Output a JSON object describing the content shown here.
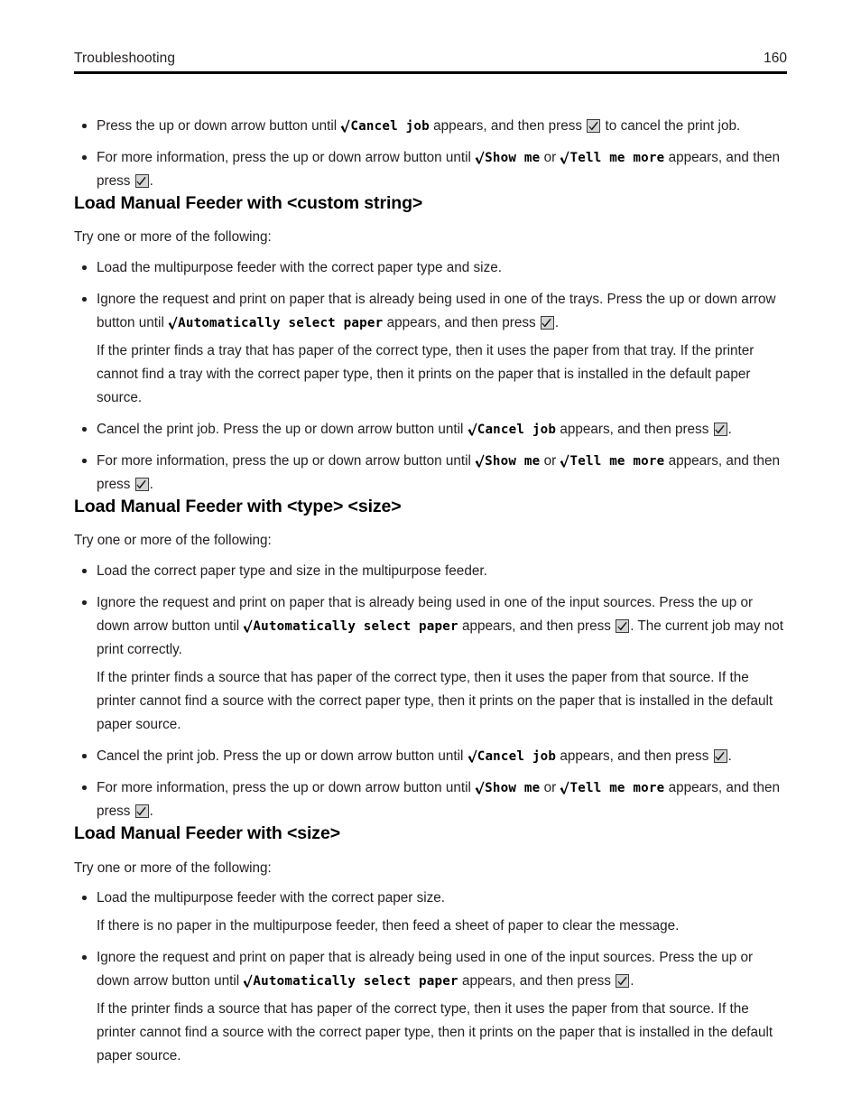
{
  "header": {
    "title": "Troubleshooting",
    "page_number": "160"
  },
  "icons": {
    "radical_check": "radical-check-glyph",
    "select_key": "select-button-checkmark-icon"
  },
  "panel_strings": {
    "cancel_job": "Cancel job",
    "show_me": "Show me",
    "tell_me_more": "Tell me more",
    "automatically_select_paper": "Automatically select paper"
  },
  "intro_text": "Try one or more of the following:",
  "fragments": {
    "press_until": "Press the up or down arrow button until ",
    "appears_then_press": " appears, and then press ",
    "to_cancel": " to cancel the print job.",
    "period": ".",
    "more_info_press_until": "For more information, press the up or down arrow button until ",
    "or": " or ",
    "appears_and": " appears, and",
    "then_press": "then press ",
    "button_until": "button until ",
    "arrow_button_until": "arrow button until ",
    "ignore_trays_lead": "Ignore the request and print on paper that is already being used in one of the trays. Press the up or down arrow",
    "ignore_sources_lead": "Ignore the request and print on paper that is already being used in one of the input sources. Press the up or down",
    "cancel_lead": "Cancel the print job. Press the up or down arrow button until ",
    "current_job_note": ". The current job may not",
    "print_correctly": "print correctly."
  },
  "sections": [
    {
      "heading": "Load Manual Feeder with <custom string>",
      "bullets": [
        {
          "kind": "plain",
          "text": "Load the multipurpose feeder with the correct paper type and size."
        },
        {
          "kind": "ignore-trays"
        },
        {
          "kind": "cancel"
        },
        {
          "kind": "more-info"
        }
      ],
      "notes": {
        "tray_note": "If the printer finds a tray that has paper of the correct type, then it uses the paper from that tray. If the printer cannot find a tray with the correct paper type, then it prints on the paper that is installed in the default paper source."
      }
    },
    {
      "heading": "Load Manual Feeder with <type> <size>",
      "bullets": [
        {
          "kind": "plain",
          "text": "Load the correct paper type and size in the multipurpose feeder."
        },
        {
          "kind": "ignore-sources-current-job"
        },
        {
          "kind": "cancel"
        },
        {
          "kind": "more-info"
        }
      ],
      "notes": {
        "source_note": "If the printer finds a source that has paper of the correct type, then it uses the paper from that source. If the printer cannot find a source with the correct paper type, then it prints on the paper that is installed in the default paper source."
      }
    },
    {
      "heading": "Load Manual Feeder with <size>",
      "bullets": [
        {
          "kind": "plain",
          "text": "Load the multipurpose feeder with the correct paper size."
        },
        {
          "kind": "note",
          "text": "If there is no paper in the multipurpose feeder, then feed a sheet of paper to clear the message."
        },
        {
          "kind": "ignore-sources"
        }
      ],
      "notes": {
        "source_note": "If the printer finds a source that has paper of the correct type, then it uses the paper from that source. If the printer cannot find a source with the correct paper type, then it prints on the paper that is installed in the default paper source."
      }
    }
  ]
}
